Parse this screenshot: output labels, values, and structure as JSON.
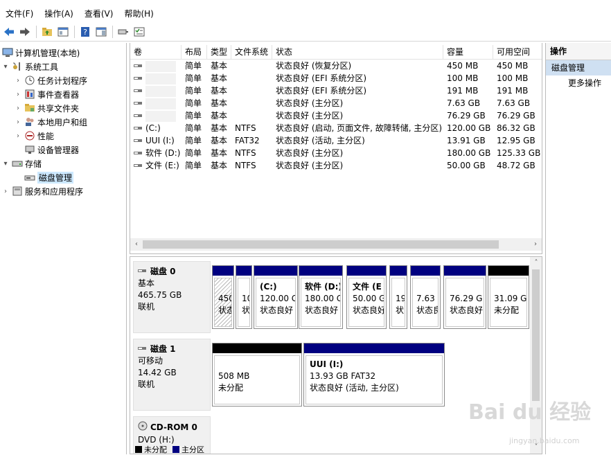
{
  "menu": [
    "文件(F)",
    "操作(A)",
    "查看(V)",
    "帮助(H)"
  ],
  "tree": [
    {
      "label": "计算机管理(本地)",
      "icon": "computer-icon",
      "level": 0,
      "twisty": ""
    },
    {
      "label": "系统工具",
      "icon": "tools-icon",
      "level": 1,
      "twisty": "▾"
    },
    {
      "label": "任务计划程序",
      "icon": "clock-icon",
      "level": 2,
      "twisty": "›"
    },
    {
      "label": "事件查看器",
      "icon": "event-viewer-icon",
      "level": 2,
      "twisty": "›"
    },
    {
      "label": "共享文件夹",
      "icon": "shared-folder-icon",
      "level": 2,
      "twisty": "›"
    },
    {
      "label": "本地用户和组",
      "icon": "users-icon",
      "level": 2,
      "twisty": "›"
    },
    {
      "label": "性能",
      "icon": "performance-icon",
      "level": 2,
      "twisty": "›"
    },
    {
      "label": "设备管理器",
      "icon": "device-manager-icon",
      "level": 2,
      "twisty": ""
    },
    {
      "label": "存储",
      "icon": "storage-icon",
      "level": 1,
      "twisty": "▾"
    },
    {
      "label": "磁盘管理",
      "icon": "disk-management-icon",
      "level": 2,
      "twisty": "",
      "selected": true
    },
    {
      "label": "服务和应用程序",
      "icon": "services-icon",
      "level": 1,
      "twisty": "›"
    }
  ],
  "volume_table": {
    "headers": [
      "卷",
      "布局",
      "类型",
      "文件系统",
      "状态",
      "容量",
      "可用空间"
    ],
    "rows": [
      [
        "",
        "简单",
        "基本",
        "",
        "状态良好 (恢复分区)",
        "450 MB",
        "450 MB"
      ],
      [
        "",
        "简单",
        "基本",
        "",
        "状态良好 (EFI 系统分区)",
        "100 MB",
        "100 MB"
      ],
      [
        "",
        "简单",
        "基本",
        "",
        "状态良好 (EFI 系统分区)",
        "191 MB",
        "191 MB"
      ],
      [
        "",
        "简单",
        "基本",
        "",
        "状态良好 (主分区)",
        "7.63 GB",
        "7.63 GB"
      ],
      [
        "",
        "简单",
        "基本",
        "",
        "状态良好 (主分区)",
        "76.29 GB",
        "76.29 GB"
      ],
      [
        "(C:)",
        "简单",
        "基本",
        "NTFS",
        "状态良好 (启动, 页面文件, 故障转储, 主分区)",
        "120.00 GB",
        "86.32 GB"
      ],
      [
        "UUI (I:)",
        "简单",
        "基本",
        "FAT32",
        "状态良好 (活动, 主分区)",
        "13.91 GB",
        "12.95 GB"
      ],
      [
        "软件 (D:)",
        "简单",
        "基本",
        "NTFS",
        "状态良好 (主分区)",
        "180.00 GB",
        "125.33 GB"
      ],
      [
        "文件 (E:)",
        "简单",
        "基本",
        "NTFS",
        "状态良好 (主分区)",
        "50.00 GB",
        "48.72 GB"
      ]
    ]
  },
  "disks": [
    {
      "name": "磁盘 0",
      "type": "基本",
      "size": "465.75 GB",
      "state": "联机",
      "partitions": [
        {
          "bar": "#000080",
          "title": "",
          "line1": "450",
          "line2": "状态",
          "hatched": true
        },
        {
          "bar": "#000080",
          "title": "",
          "line1": "10",
          "line2": "状"
        },
        {
          "bar": "#000080",
          "title": "(C:)",
          "line1": "120.00 G",
          "line2": "状态良好"
        },
        {
          "bar": "#000080",
          "title": "软件 (D:)",
          "line1": "180.00 G",
          "line2": "状态良好"
        },
        {
          "bar": "#000080",
          "title": "文件 (E",
          "line1": "50.00 G",
          "line2": "状态良好"
        },
        {
          "bar": "#000080",
          "title": "",
          "line1": "19",
          "line2": "状"
        },
        {
          "bar": "#000080",
          "title": "",
          "line1": "7.63 G",
          "line2": "状态良"
        },
        {
          "bar": "#000080",
          "title": "",
          "line1": "76.29 G",
          "line2": "状态良好"
        },
        {
          "bar": "#000000",
          "title": "",
          "line1": "31.09 G",
          "line2": "未分配"
        }
      ]
    },
    {
      "name": "磁盘 1",
      "type": "可移动",
      "size": "14.42 GB",
      "state": "联机",
      "partitions": [
        {
          "bar": "#000000",
          "title": "",
          "line1": "508 MB",
          "line2": "未分配"
        },
        {
          "bar": "#000080",
          "title": "UUI (I:)",
          "line1": "13.93 GB FAT32",
          "line2": "状态良好 (活动, 主分区)"
        }
      ]
    },
    {
      "name": "CD-ROM 0",
      "type": "DVD (H:)",
      "size": "",
      "state": "",
      "partitions": []
    }
  ],
  "legend": [
    {
      "label": "未分配",
      "color": "#000000"
    },
    {
      "label": "主分区",
      "color": "#000080"
    }
  ],
  "actions": {
    "header": "操作",
    "section": "磁盘管理",
    "more": "更多操作"
  },
  "watermark": {
    "text": "Bai du 经验",
    "url": "jingyan.baidu.com"
  }
}
